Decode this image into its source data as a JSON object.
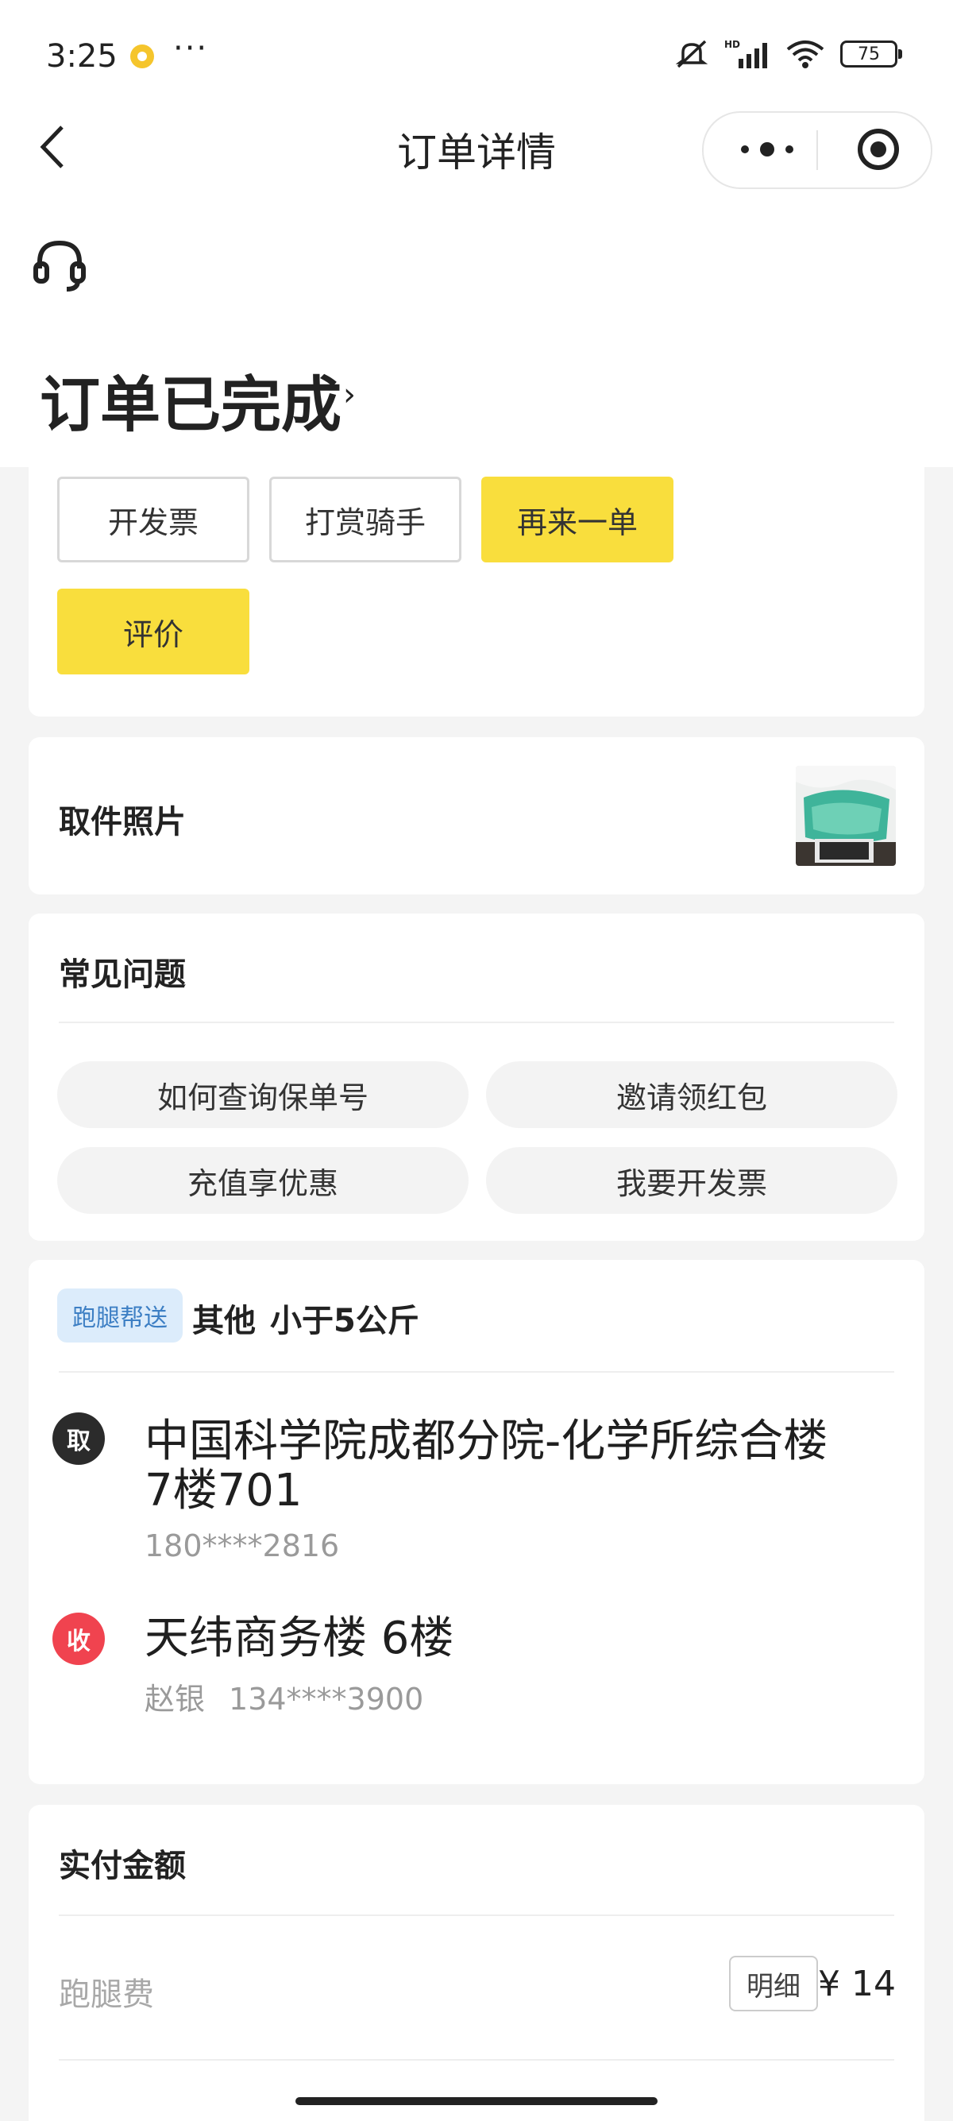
{
  "status_bar": {
    "time": "3:25",
    "more": "···",
    "network": "HD",
    "battery": "75"
  },
  "nav": {
    "title": "订单详情"
  },
  "order": {
    "status_title": "订单已完成",
    "status_arrow": "›"
  },
  "actions": {
    "invoice_label": "开发票",
    "tip_label": "打赏骑手",
    "reorder_label": "再来一单",
    "review_label": "评价"
  },
  "pickup_photo": {
    "title": "取件照片"
  },
  "faq": {
    "title": "常见问题",
    "items": [
      "如何查询保单号",
      "邀请领红包",
      "充值享优惠",
      "我要开发票"
    ]
  },
  "delivery": {
    "service_tag": "跑腿帮送",
    "category": "其他",
    "weight": "小于5公斤",
    "pickup": {
      "badge": "取",
      "address_line1": "中国科学院成都分院-化学所综合楼",
      "address_line2": "7楼701",
      "contact": "180****2816"
    },
    "dropoff": {
      "badge": "收",
      "address": "天纬商务楼 6楼",
      "name": "赵银",
      "phone": "134****3900"
    }
  },
  "payment": {
    "title": "实付金额",
    "fee_label": "跑腿费",
    "detail_label": "明细",
    "amount": "¥ 14"
  },
  "colors": {
    "accent_yellow": "#f9de3d",
    "pickup_badge": "#2b2b2b",
    "dropoff_badge": "#f0434f",
    "tag_bg": "#dcecfb",
    "tag_text": "#3d7fc4"
  }
}
